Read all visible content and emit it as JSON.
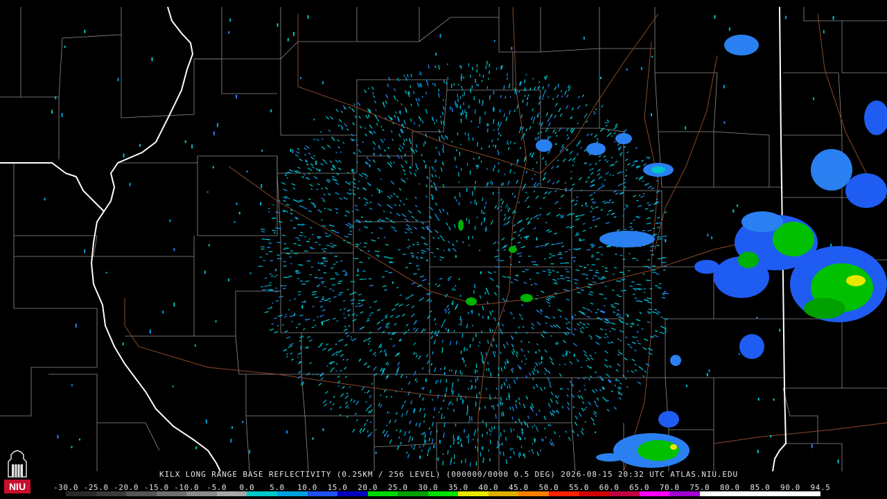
{
  "caption": "KILX LONG RANGE BASE REFLECTIVITY (0.25KM / 256 LEVEL) (000000/0000 0.5 DEG) 2026-08-15 20:32 UTC  ATLAS.NIU.EDU",
  "logo": {
    "text": "NIU",
    "icon": "university-tower-logo-icon"
  },
  "colorbar": {
    "labels": [
      "-30.0",
      "-25.0",
      "-20.0",
      "-15.0",
      "-10.0",
      "-5.0",
      "0.0",
      "5.0",
      "10.0",
      "15.0",
      "20.0",
      "25.0",
      "30.0",
      "35.0",
      "40.0",
      "45.0",
      "50.0",
      "55.0",
      "60.0",
      "65.0",
      "70.0",
      "75.0",
      "80.0",
      "85.0",
      "90.0",
      "94.5"
    ],
    "colors": [
      "#2a2a2a",
      "#3a3a3a",
      "#555555",
      "#707070",
      "#8c8c8c",
      "#a8a8a8",
      "#00c8c8",
      "#00a0e0",
      "#2050f0",
      "#0000c0",
      "#00d800",
      "#00a000",
      "#00e000",
      "#e8e800",
      "#e0b000",
      "#ff8000",
      "#ff2000",
      "#d00000",
      "#c00040",
      "#ff00ff",
      "#a000d0",
      "#ffffff",
      "#ffffff",
      "#ffffff",
      "#ffffff"
    ]
  },
  "map": {
    "radar_site": "KILX",
    "boundary_color": "#9a9a9a",
    "state_line_color": "#ffffff",
    "road_color": "#a0522d"
  }
}
